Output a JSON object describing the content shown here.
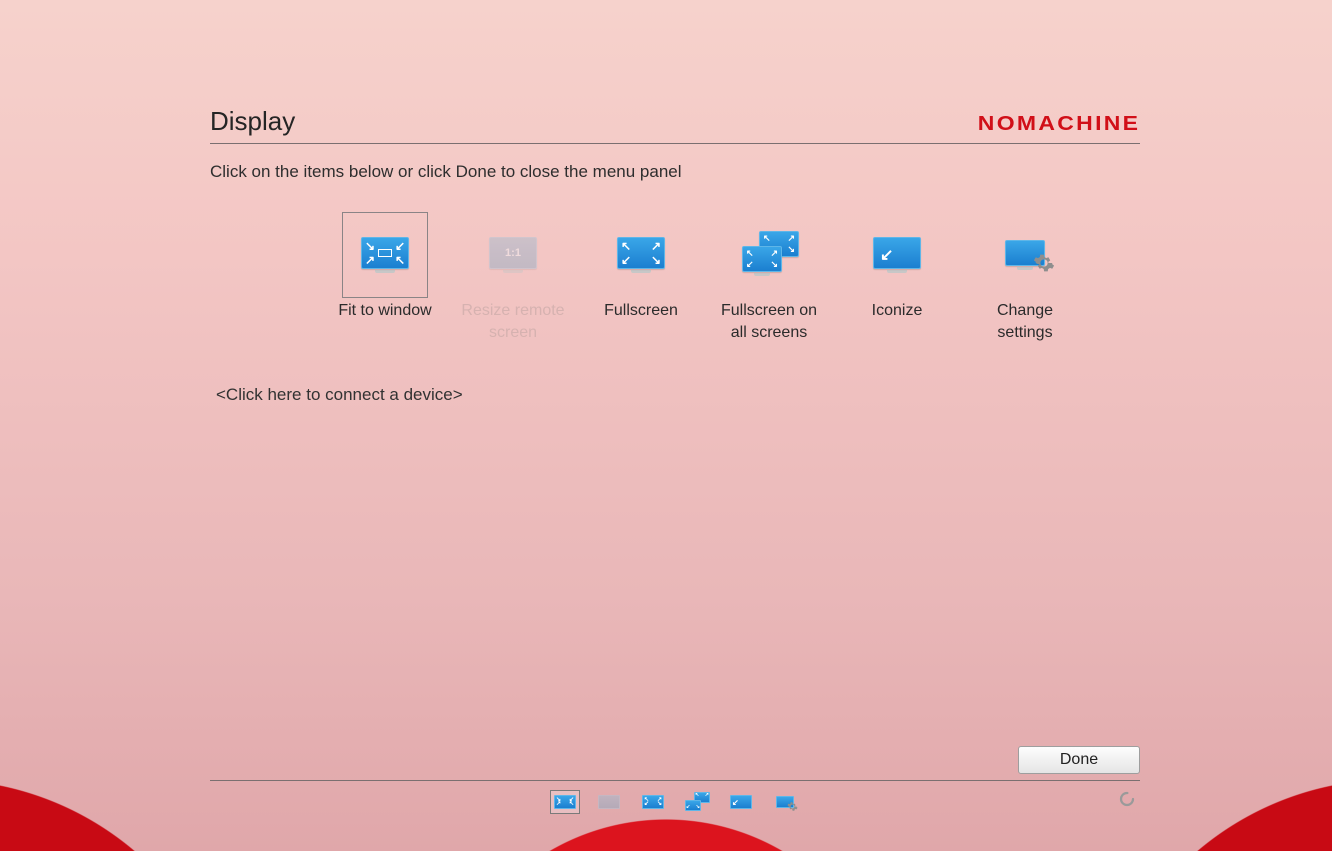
{
  "header": {
    "title": "Display",
    "brand": "NOMACHINE"
  },
  "instruction": "Click on the items below or click Done to close the menu panel",
  "options": [
    {
      "id": "fit-to-window",
      "label": "Fit to window",
      "selected": true,
      "disabled": false
    },
    {
      "id": "resize-remote-screen",
      "label": "Resize remote screen",
      "selected": false,
      "disabled": true
    },
    {
      "id": "fullscreen",
      "label": "Fullscreen",
      "selected": false,
      "disabled": false
    },
    {
      "id": "fullscreen-all",
      "label": "Fullscreen on all screens",
      "selected": false,
      "disabled": false
    },
    {
      "id": "iconize",
      "label": "Iconize",
      "selected": false,
      "disabled": false
    },
    {
      "id": "change-settings",
      "label": "Change settings",
      "selected": false,
      "disabled": false
    }
  ],
  "connect_device": "<Click here to connect a device>",
  "footer": {
    "done_label": "Done"
  },
  "bottom_icons": [
    {
      "id": "fit-to-window",
      "selected": true
    },
    {
      "id": "resize-remote-screen",
      "selected": false
    },
    {
      "id": "fullscreen",
      "selected": false
    },
    {
      "id": "fullscreen-all",
      "selected": false
    },
    {
      "id": "iconize",
      "selected": false
    },
    {
      "id": "change-settings",
      "selected": false
    }
  ]
}
